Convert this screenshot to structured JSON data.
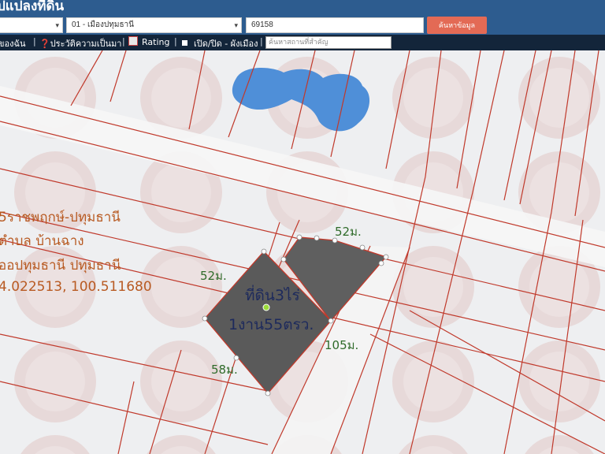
{
  "app": {
    "title": "ปแปลงที่ดิน",
    "province_select": "",
    "district_select": "01 - เมืองปทุมธานี",
    "parcel_number": "69158",
    "search_button": "ค้นหาข้อมูล"
  },
  "toolbar": {
    "items": [
      "ของฉัน",
      "ประวัติความเป็นมา",
      "Rating",
      "เปิด/ปิด - ผังเมือง"
    ],
    "search_placeholder": "ค้นหาสถานที่สำคัญ"
  },
  "map": {
    "address_lines": [
      "5ราชพฤกษ์-ปทุมธานี",
      "ตำบล บ้านฉาง",
      "ออปทุมธานี ปทุมธานี",
      "4.022513, 100.511680"
    ],
    "plot_label_line1": "ที่ดิน3ไร่",
    "plot_label_line2": "1งาน55ตรว.",
    "measurements": {
      "top": "52ม.",
      "left": "52ม.",
      "right": "105ม.",
      "bottom": "58ม."
    },
    "colors": {
      "header": "#2d5c8f",
      "toolbar": "#13253a",
      "search_button": "#e36a55",
      "parcel_lines": "#c0392b",
      "plot_fill": "#5a5a5a",
      "water": "#4f8fd8"
    }
  }
}
